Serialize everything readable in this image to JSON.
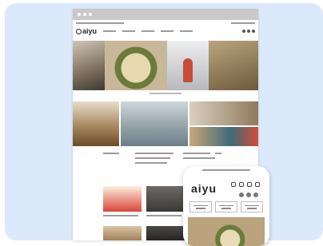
{
  "site": {
    "logo": "aiyu"
  },
  "phone": {
    "logo": "aiyu"
  },
  "colors": {
    "background_card": "#dbe9fb",
    "titlebar": "#c9c9c9",
    "text": "#222222"
  },
  "icons": [
    "search-icon",
    "cart-icon",
    "user-icon",
    "menu-icon"
  ]
}
